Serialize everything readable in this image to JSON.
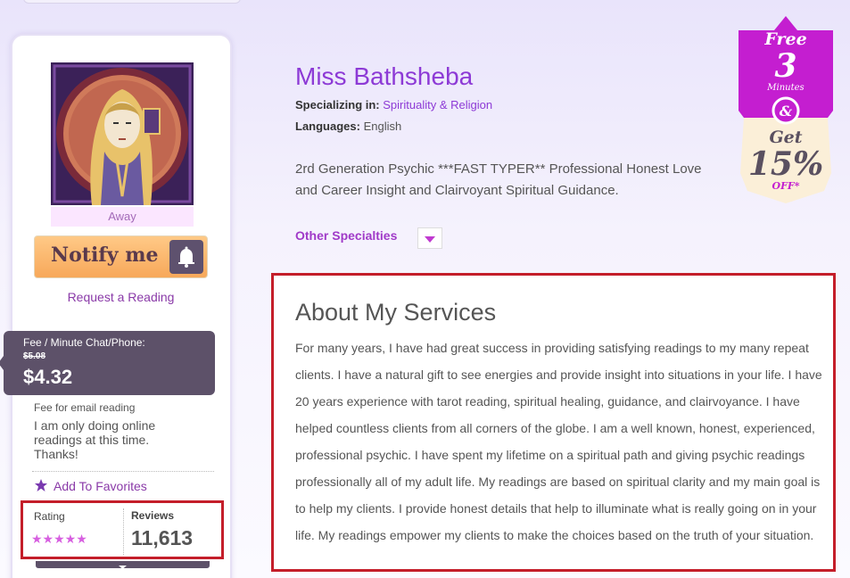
{
  "profile": {
    "status": "Away",
    "notify_label": "Notify me",
    "request_label": "Request a Reading",
    "fee_label": "Fee / Minute Chat/Phone:",
    "old_price": "$5.08",
    "new_price": "$4.32",
    "email_fee_label": "Fee for email reading",
    "email_message": "I am only doing online readings at this time. Thanks!",
    "favorites_label": "Add To Favorites",
    "rating_label": "Rating",
    "rating_stars": "★★★★★",
    "rating_value": 5,
    "reviews_label": "Reviews",
    "reviews_count": "11,613"
  },
  "advisor": {
    "name": "Miss Bathsheba",
    "specializing_label": "Specializing in:",
    "specialty": "Spirituality & Religion",
    "languages_label": "Languages:",
    "languages": "English",
    "bio": "2rd Generation Psychic ***FAST TYPER** Professional Honest Love and Career Insight and Clairvoyant Spiritual Guidance.",
    "other_specialties_label": "Other Specialties"
  },
  "about": {
    "title": "About My Services",
    "text": "For many years, I have had great success in providing satisfying readings to my many repeat clients. I have a natural gift to see energies and provide insight into situations in your life. I have 20 years experience with tarot reading, spiritual healing, guidance, and clairvoyance. I have helped countless clients from all corners of the globe. I am a well known, honest, experienced, professional psychic. I have spent my lifetime on a spiritual path and giving psychic readings professionally all of my adult life. My readings are based on spiritual clarity and my main goal is to help my clients. I provide honest details that help to illuminate what is really going on in your life. My readings empower my clients to make the choices based on the truth of your situation."
  },
  "promo": {
    "free": "Free",
    "minutes_number": "3",
    "minutes_label": "Minutes",
    "amp": "&",
    "get": "Get",
    "percent": "15%",
    "off": "OFF*"
  },
  "colors": {
    "accent": "#8d3ad6",
    "highlight_border": "#c41e2a",
    "panel_dark": "#5d5169",
    "notify_orange": "#f7a85a",
    "promo_magenta": "#c41ed0"
  },
  "icons": [
    "bell-icon",
    "star-icon",
    "chevron-down-icon"
  ]
}
